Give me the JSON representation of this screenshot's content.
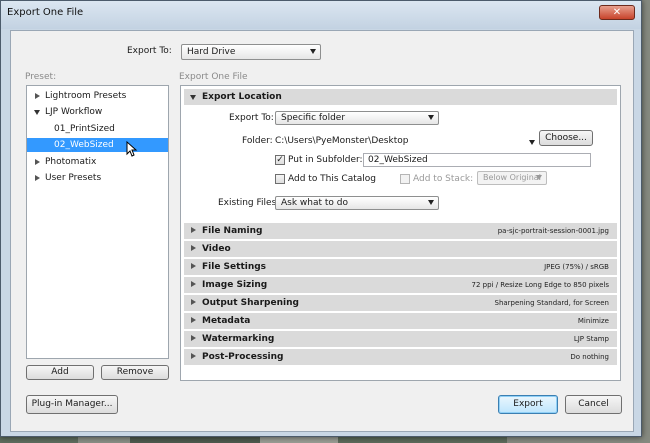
{
  "window": {
    "title": "Export One File",
    "close_glyph": "✕"
  },
  "export_to": {
    "label": "Export To:",
    "value": "Hard Drive"
  },
  "preset": {
    "heading": "Preset:",
    "items": [
      {
        "label": "Lightroom Presets"
      },
      {
        "label": "LJP Workflow"
      },
      {
        "label": "01_PrintSized"
      },
      {
        "label": "02_WebSized"
      },
      {
        "label": "Photomatix"
      },
      {
        "label": "User Presets"
      }
    ],
    "add_label": "Add",
    "remove_label": "Remove"
  },
  "right_heading": "Export One File",
  "export_location": {
    "title": "Export Location",
    "export_to_label": "Export To:",
    "export_to_value": "Specific folder",
    "folder_label": "Folder:",
    "folder_value": "C:\\Users\\PyeMonster\\Desktop",
    "choose_label": "Choose...",
    "subfolder_label": "Put in Subfolder:",
    "subfolder_value": "02_WebSized",
    "subfolder_checked": true,
    "catalog_label": "Add to This Catalog",
    "stack_label": "Add to Stack:",
    "stack_value": "Below Original",
    "existing_label": "Existing Files:",
    "existing_value": "Ask what to do"
  },
  "sections": [
    {
      "name": "File Naming",
      "summary": "pa-sjc-portrait-session-0001.jpg"
    },
    {
      "name": "Video",
      "summary": ""
    },
    {
      "name": "File Settings",
      "summary": "JPEG (75%) / sRGB"
    },
    {
      "name": "Image Sizing",
      "summary": "72 ppi / Resize Long Edge to 850 pixels"
    },
    {
      "name": "Output Sharpening",
      "summary": "Sharpening Standard, for Screen"
    },
    {
      "name": "Metadata",
      "summary": "Minimize"
    },
    {
      "name": "Watermarking",
      "summary": "LJP Stamp"
    },
    {
      "name": "Post-Processing",
      "summary": "Do nothing"
    }
  ],
  "footer": {
    "plugin_label": "Plug-in Manager...",
    "export_label": "Export",
    "cancel_label": "Cancel"
  },
  "colors": {
    "selection": "#3399ff",
    "section_bg": "#dadada",
    "dialog_bg": "#f0f0f0"
  }
}
